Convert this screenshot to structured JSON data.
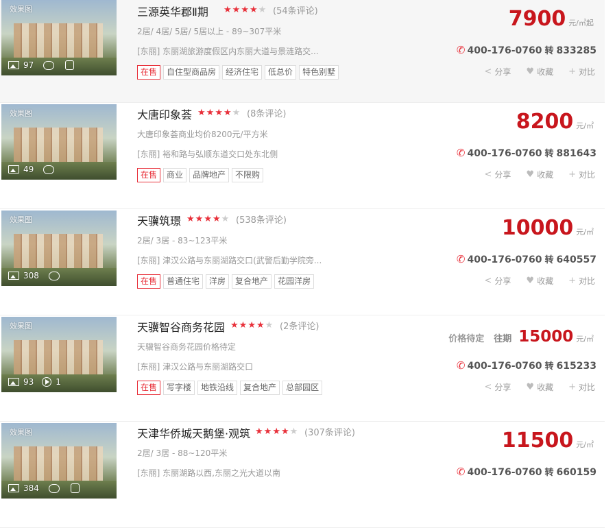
{
  "listings": [
    {
      "name": "三源英华郡Ⅱ期",
      "stars": 3.5,
      "reviews": "(54条评论)",
      "info": "2居/ 4居/ 5居/ 5居以上  -  89~307平米",
      "address": "[东丽] 东丽湖旅游度假区内东丽大道与景涟路交...",
      "tags": [
        "在售",
        "自住型商品房",
        "经济住宅",
        "低总价",
        "特色别墅"
      ],
      "price_pending": "",
      "price_label": "",
      "price": "7900",
      "unit": "元/㎡起",
      "phone": "400-176-0760",
      "zhuan": "转",
      "ext": "833285",
      "photos": "97",
      "comment_count": "",
      "has_360": true,
      "has_video": false,
      "video_count": "",
      "image_tag": "效果图",
      "actions": [
        "分享",
        "收藏",
        "对比"
      ]
    },
    {
      "name": "大唐印象荟",
      "stars": 3.5,
      "reviews": "(8条评论)",
      "info": "大唐印象荟商业均价8200元/平方米",
      "address": "[东丽] 裕和路与弘顺东道交口处东北侧",
      "tags": [
        "在售",
        "商业",
        "品牌地产",
        "不限购"
      ],
      "price_pending": "",
      "price_label": "",
      "price": "8200",
      "unit": "元/㎡",
      "phone": "400-176-0760",
      "zhuan": "转",
      "ext": "881643",
      "photos": "49",
      "comment_count": "",
      "has_360": false,
      "has_video": false,
      "video_count": "",
      "image_tag": "效果图",
      "actions": [
        "分享",
        "收藏",
        "对比"
      ]
    },
    {
      "name": "天骥筑璟",
      "stars": 3.5,
      "reviews": "(538条评论)",
      "info": "2居/ 3居  -  83~123平米",
      "address": "[东丽] 津汉公路与东丽湖路交口(武警后勤学院旁...",
      "tags": [
        "在售",
        "普通住宅",
        "洋房",
        "复合地产",
        "花园洋房"
      ],
      "price_pending": "",
      "price_label": "",
      "price": "10000",
      "unit": "元/㎡",
      "phone": "400-176-0760",
      "zhuan": "转",
      "ext": "640557",
      "photos": "308",
      "comment_count": "",
      "has_360": false,
      "has_video": false,
      "video_count": "",
      "image_tag": "效果图",
      "actions": [
        "分享",
        "收藏",
        "对比"
      ]
    },
    {
      "name": "天骥智谷商务花园",
      "stars": 3.5,
      "reviews": "(2条评论)",
      "info": "天骥智谷商务花园价格待定",
      "address": "[东丽] 津汉公路与东丽湖路交口",
      "tags": [
        "在售",
        "写字楼",
        "地铁沿线",
        "复合地产",
        "总部园区"
      ],
      "price_pending": "价格待定",
      "price_label": "往期",
      "price": "15000",
      "unit": "元/㎡",
      "phone": "400-176-0760",
      "zhuan": "转",
      "ext": "615233",
      "photos": "93",
      "comment_count": "",
      "has_360": false,
      "has_video": true,
      "video_count": "1",
      "image_tag": "效果图",
      "actions": [
        "分享",
        "收藏",
        "对比"
      ]
    },
    {
      "name": "天津华侨城天鹅堡·观筑",
      "stars": 3.5,
      "reviews": "(307条评论)",
      "info": "2居/ 3居  -  88~120平米",
      "address": "[东丽] 东丽湖路以西,东丽之光大道以南",
      "tags": [],
      "price_pending": "",
      "price_label": "",
      "price": "11500",
      "unit": "元/㎡",
      "phone": "400-176-0760",
      "zhuan": "转",
      "ext": "660159",
      "photos": "384",
      "comment_count": "",
      "has_360": true,
      "has_video": false,
      "video_count": "",
      "image_tag": "效果图",
      "actions": [
        "分享",
        "收藏",
        "对比"
      ]
    }
  ],
  "colors": {
    "accent": "#c8161d",
    "star": "#e8303a",
    "muted": "#999999"
  },
  "icons": {
    "photo": "photo-icon",
    "comment": "comment-icon",
    "video": "video-icon",
    "vr": "vr-360-icon",
    "phone": "phone-icon",
    "share": "share-icon",
    "favorite": "heart-icon",
    "compare": "plus-icon"
  }
}
